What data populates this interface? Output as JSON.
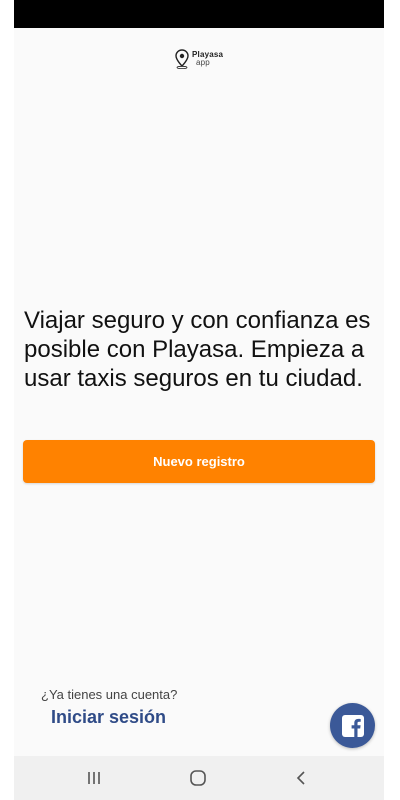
{
  "app": {
    "logo_text": "Playasa",
    "logo_subtext": "app",
    "logo_icon": "map-pin-icon"
  },
  "main": {
    "tagline": "Viajar seguro y con confianza es posible con Playasa. Empieza a usar taxis seguros en tu ciudad.",
    "register_button_label": "Nuevo registro"
  },
  "account": {
    "question": "¿Ya tienes una cuenta?",
    "login_label": "Iniciar sesión"
  },
  "social": {
    "facebook_icon": "facebook-icon"
  },
  "navigation": {
    "recent_icon": "recent-apps-icon",
    "home_icon": "home-icon",
    "back_icon": "back-icon"
  },
  "colors": {
    "accent": "#ff8200",
    "link": "#2f4b87",
    "facebook": "#3b5998"
  }
}
